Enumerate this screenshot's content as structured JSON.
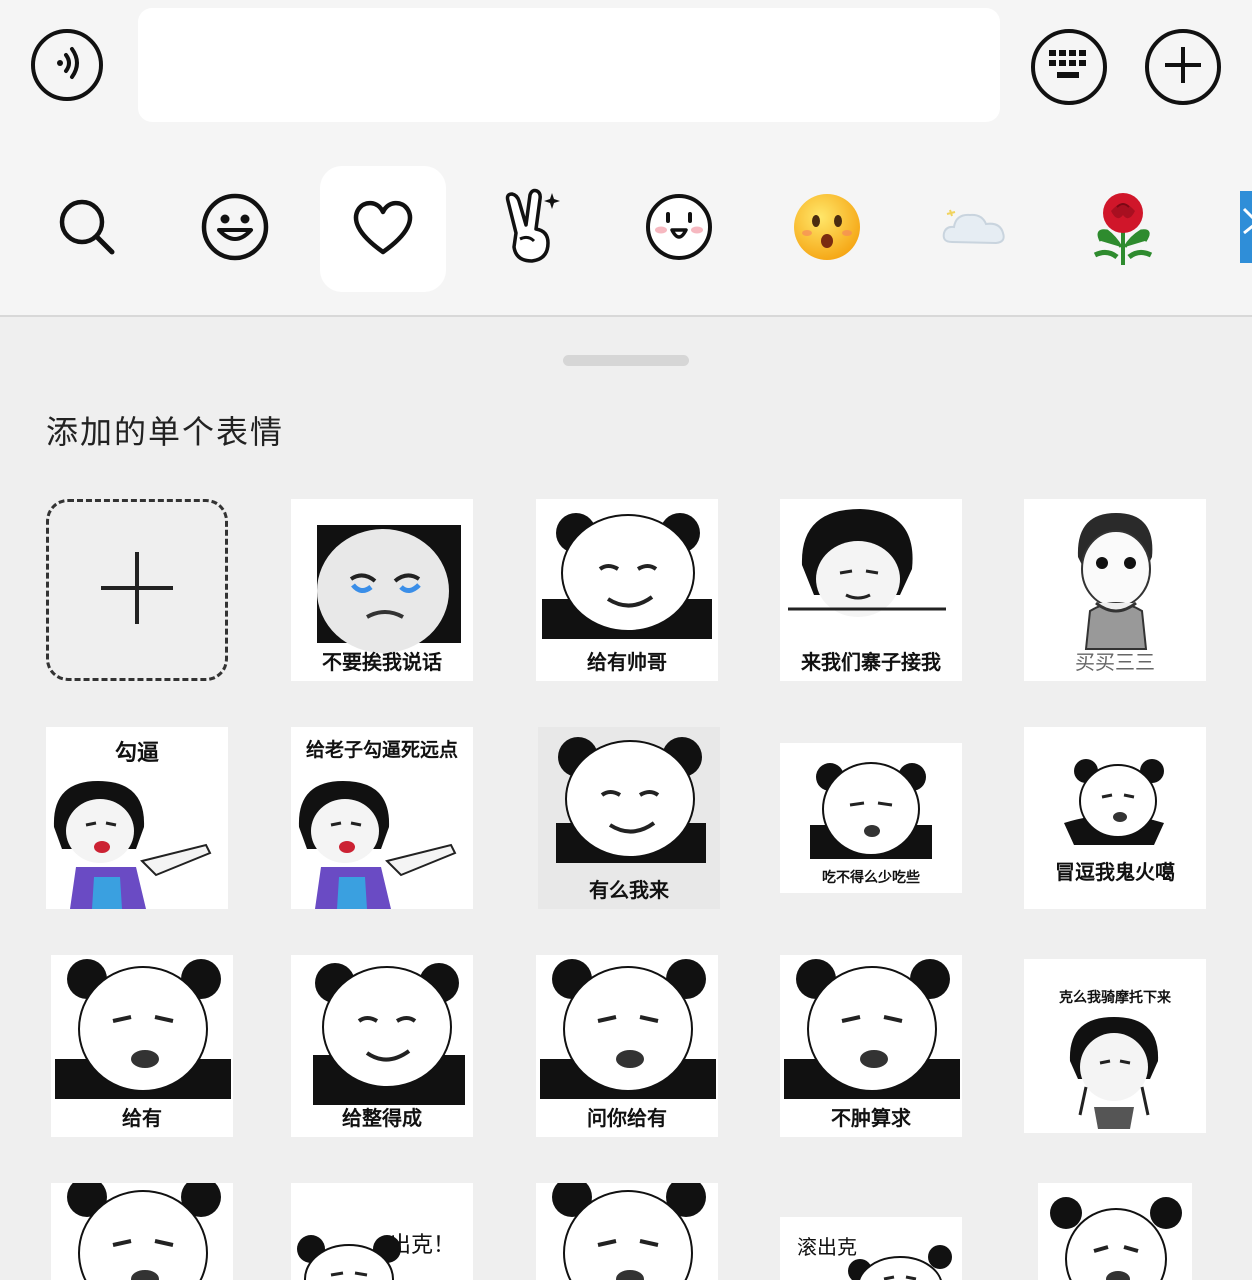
{
  "panel": {
    "section_title": "添加的单个表情"
  },
  "categories": [
    {
      "name": "search"
    },
    {
      "name": "emoji"
    },
    {
      "name": "favorites",
      "active": true
    },
    {
      "name": "gesture"
    },
    {
      "name": "cute-face"
    },
    {
      "name": "yellow-face"
    },
    {
      "name": "cloud"
    },
    {
      "name": "rose"
    },
    {
      "name": "partial"
    }
  ],
  "stickers": {
    "r1": [
      "不要挨我说话",
      "给有帅哥",
      "来我们寨子接我",
      "买买三三"
    ],
    "r2": [
      "勾逼",
      "给老子勾逼死远点",
      "有么我来",
      "吃不得么少吃些",
      "冒逗我鬼火噶"
    ],
    "r3": [
      "给有",
      "给整得成",
      "问你给有",
      "不肿算求",
      "克么我骑摩托下来"
    ],
    "r4": [
      "",
      "出克！",
      "",
      "滚出克",
      ""
    ]
  }
}
